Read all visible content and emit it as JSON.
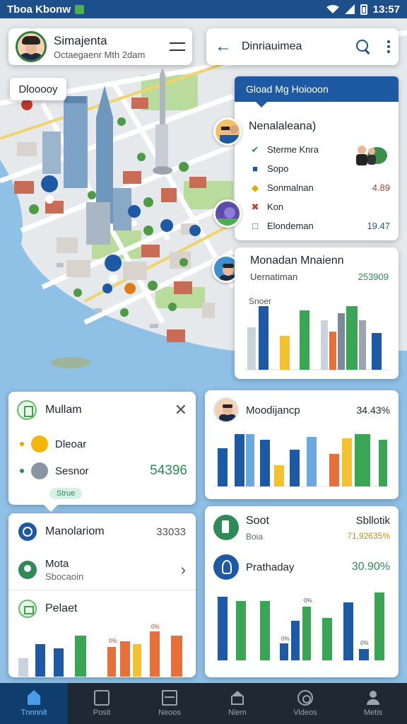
{
  "status_bar": {
    "app_name": "Tboa Kbonw",
    "time": "13:57"
  },
  "profile": {
    "name": "Simajenta",
    "subtitle": "Octaegaenr Mth 2dam"
  },
  "map_tag": {
    "label": "Dlooooy"
  },
  "search_bar": {
    "title": "Dinriauimea"
  },
  "list_panel": {
    "header": "Gload Mg Hoiooon",
    "title": "Nenalaleana)",
    "items": [
      {
        "icon": "check-icon",
        "label": "Sterme Knra",
        "value": "",
        "color": "#2e8b57"
      },
      {
        "icon": "folder-icon",
        "label": "Sopo",
        "value": "",
        "color": "#1d5aa3"
      },
      {
        "icon": "diamond-icon",
        "label": "Sonmalnan",
        "value": "4.89",
        "color": "#e0a800"
      },
      {
        "icon": "cross-icon",
        "label": "Kon",
        "value": "",
        "color": "#c0392b"
      },
      {
        "icon": "square-icon",
        "label": "Elondeman",
        "value": "19.47",
        "color": "#1d5aa3"
      }
    ]
  },
  "monitor_panel": {
    "title": "Monadan Mnaienn",
    "subtitle": "Uernatiman",
    "value": "253909",
    "chart_label": "Snoer"
  },
  "module_panel": {
    "title": "Moodijancp",
    "value": "34.43%"
  },
  "mullam_panel": {
    "title": "Mullam",
    "rows": [
      {
        "label": "Dleoar",
        "value": ""
      },
      {
        "label": "Sesnor",
        "value": "54396"
      }
    ],
    "chip": "Strue"
  },
  "mono_panel": {
    "title": "Manolariom",
    "value": "33033",
    "mota_title": "Mota",
    "mota_sub": "Sbocaoin",
    "chart_title": "Pelaet",
    "bar_labels": [
      "0%",
      "0%"
    ]
  },
  "soot_panel": {
    "title": "Soot",
    "sub": "Boia",
    "right_title": "Sbllotik",
    "right_value": "71,92635%",
    "bday_title": "Prathaday",
    "bday_value": "30.90%",
    "bar_labels": [
      "0%",
      "0%",
      "0%"
    ]
  },
  "nav": [
    {
      "label": "Tnnnnit",
      "icon": "home-icon",
      "active": true
    },
    {
      "label": "Posit",
      "icon": "post-icon",
      "active": false
    },
    {
      "label": "Neoos",
      "icon": "news-icon",
      "active": false
    },
    {
      "label": "Niem",
      "icon": "home-outline-icon",
      "active": false
    },
    {
      "label": "Videos",
      "icon": "video-icon",
      "active": false
    },
    {
      "label": "Metis",
      "icon": "profile-icon",
      "active": false
    }
  ],
  "colors": {
    "primary": "#1d5aa3",
    "accent_green": "#2e8b57",
    "nav_bg": "#1f2933"
  }
}
